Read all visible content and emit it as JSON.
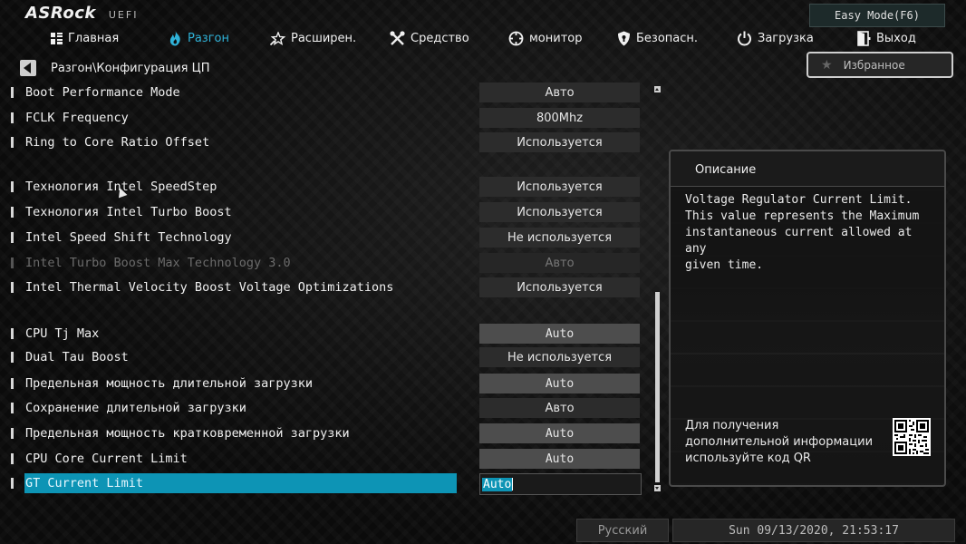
{
  "header": {
    "brand": "ASRock",
    "uefi": "UEFI",
    "easy_mode": "Easy Mode(F6)"
  },
  "nav": [
    {
      "id": "main",
      "label": "Главная",
      "icon": "grid-icon"
    },
    {
      "id": "oc",
      "label": "Разгон",
      "icon": "flame-icon",
      "active": true
    },
    {
      "id": "advanced",
      "label": "Расширен.",
      "icon": "star-wrench-icon"
    },
    {
      "id": "tools",
      "label": "Средство",
      "icon": "tools-icon"
    },
    {
      "id": "monitor",
      "label": "монитор",
      "icon": "crosshair-icon"
    },
    {
      "id": "security",
      "label": "Безопасн.",
      "icon": "shield-icon"
    },
    {
      "id": "boot",
      "label": "Загрузка",
      "icon": "power-icon"
    },
    {
      "id": "exit",
      "label": "Выход",
      "icon": "exit-door-icon"
    }
  ],
  "breadcrumb": "Разгон\\Конфигурация ЦП",
  "favorites": "Избранное",
  "settings": [
    {
      "label": "Boot Performance Mode",
      "value": "Авто"
    },
    {
      "label": "FCLK Frequency",
      "value": "800Mhz"
    },
    {
      "label": "Ring to Core Ratio Offset",
      "value": "Используется"
    },
    {
      "label": "Технология Intel SpeedStep",
      "value": "Используется"
    },
    {
      "label": "Технология Intel Turbo Boost",
      "value": "Используется"
    },
    {
      "label": "Intel Speed Shift Technology",
      "value": "Не используется"
    },
    {
      "label": "Intel Turbo Boost Max Technology 3.0",
      "value": "Авто"
    },
    {
      "label": "Intel Thermal Velocity Boost Voltage Optimizations",
      "value": "Используется"
    },
    {
      "label": "CPU Tj Max",
      "value": "Auto"
    },
    {
      "label": "Dual Tau Boost",
      "value": "Не используется"
    },
    {
      "label": "Предельная мощность длительной загрузки",
      "value": "Auto"
    },
    {
      "label": "Сохранение длительной загрузки",
      "value": "Авто"
    },
    {
      "label": "Предельная мощность кратковременной загрузки",
      "value": "Auto"
    },
    {
      "label": "CPU Core Current Limit",
      "value": "Auto"
    },
    {
      "label": "GT Current Limit",
      "value": "Auto"
    }
  ],
  "description": {
    "title": "Описание",
    "text_lines": [
      "Voltage Regulator Current Limit.",
      "This value represents the Maximum",
      "instantaneous current allowed at any",
      "given time."
    ],
    "qr_lines": [
      "Для получения",
      "дополнительной информации",
      "используйте код QR"
    ]
  },
  "footer": {
    "language": "Русский",
    "datetime": "Sun 09/13/2020, 21:53:17"
  },
  "colors": {
    "accent": "#2fb2d8",
    "selection": "#0d94b5"
  }
}
